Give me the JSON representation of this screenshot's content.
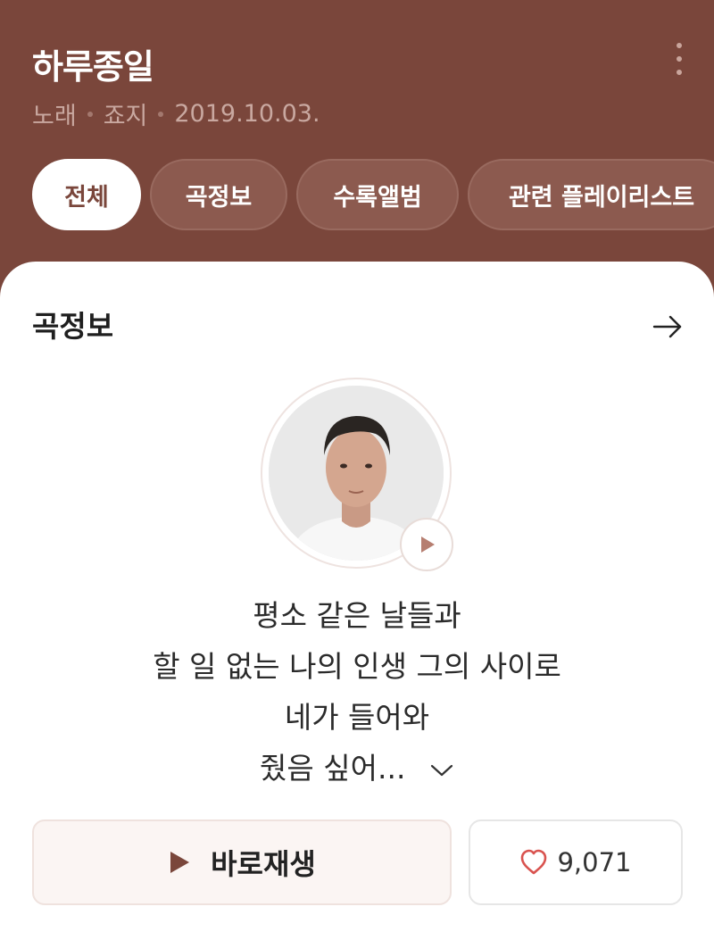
{
  "header": {
    "title": "하루종일",
    "meta": [
      "노래",
      "죠지",
      "2019.10.03."
    ],
    "more_icon": "more-vertical-icon"
  },
  "tabs": [
    {
      "label": "전체",
      "active": true
    },
    {
      "label": "곡정보",
      "active": false
    },
    {
      "label": "수록앨범",
      "active": false
    },
    {
      "label": "관련 플레이리스트",
      "active": false
    }
  ],
  "song_info": {
    "section_title": "곡정보",
    "arrow_icon": "arrow-right-icon",
    "lyrics": [
      "평소 같은 날들과",
      "할 일 없는 나의 인생 그의 사이로",
      "네가 들어와",
      "줬음 싶어..."
    ],
    "expand_icon": "chevron-down-icon"
  },
  "actions": {
    "play_label": "바로재생",
    "like_count": "9,071",
    "like_icon": "heart-icon"
  },
  "colors": {
    "brand": "#7a463b",
    "accent": "#8c5a4f",
    "heart": "#d9534f"
  }
}
